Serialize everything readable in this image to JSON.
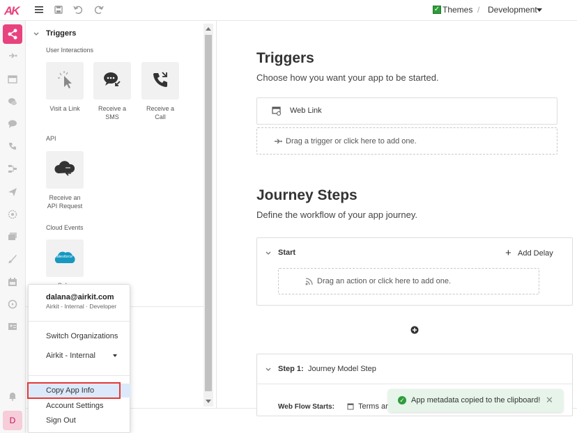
{
  "topbar": {
    "logo_text": "AK",
    "themes_label": "Themes",
    "separator": "/",
    "environment": "Development"
  },
  "rail": {
    "avatar_initial": "D"
  },
  "triggers_panel": {
    "title": "Triggers",
    "sections": [
      {
        "label": "User Interactions"
      },
      {
        "label": "API"
      },
      {
        "label": "Cloud Events"
      }
    ],
    "tiles": [
      {
        "label_line1": "Visit a Link",
        "label_line2": ""
      },
      {
        "label_line1": "Receive a",
        "label_line2": "SMS"
      },
      {
        "label_line1": "Receive a",
        "label_line2": "Call"
      },
      {
        "label_line1": "Receive an",
        "label_line2": "API Request"
      },
      {
        "label_line1": "Sal...",
        "label_line2": ""
      }
    ],
    "salesforce_text": "salesforce"
  },
  "main": {
    "triggers_title": "Triggers",
    "triggers_subtitle": "Choose how you want your app to be started.",
    "web_link_label": "Web Link",
    "drag_trigger": "Drag a trigger or click here to add one.",
    "journey_title": "Journey Steps",
    "journey_subtitle": "Define the workflow of your app journey.",
    "start_label": "Start",
    "add_delay": "Add Delay",
    "drag_action": "Drag an action or click here to add one.",
    "step1_label": "Step 1:",
    "step1_name": "Journey Model Step",
    "web_flow_starts": "Web Flow Starts:",
    "terms": "Terms an..."
  },
  "account_menu": {
    "email": "dalana@airkit.com",
    "org_line": "Airkit - Internal · Developer",
    "switch_orgs": "Switch Organizations",
    "current_org": "Airkit - Internal",
    "copy_app_info": "Copy App Info",
    "account_settings": "Account Settings",
    "sign_out": "Sign Out"
  },
  "toast": {
    "message": "App metadata copied to the clipboard!",
    "close": "✕"
  },
  "colors": {
    "brand": "#e8437e",
    "success": "#2e9c3a",
    "toast_bg": "#e6f4ea",
    "highlight": "#dce9fb",
    "annotation": "#e53935"
  }
}
